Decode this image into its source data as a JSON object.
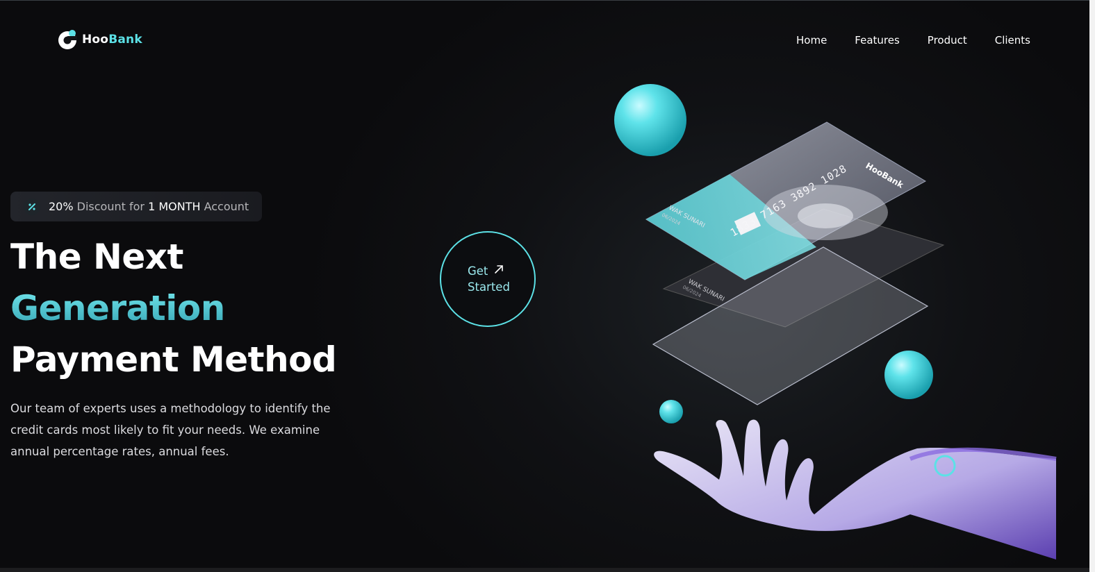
{
  "brand": {
    "name_part1": "Hoo",
    "name_part2": "Bank",
    "accent": "#5ce1e6"
  },
  "nav": {
    "items": [
      "Home",
      "Features",
      "Product",
      "Clients"
    ]
  },
  "badge": {
    "icon": "discount-icon",
    "percent": "20%",
    "text1": " Discount for ",
    "highlight": "1 MONTH",
    "text2": " Account"
  },
  "hero": {
    "line1": "The Next",
    "line2": "Generation",
    "line3": "Payment Method",
    "description": "Our team of experts uses a methodology to identify the credit cards most likely to fit your needs. We examine annual percentage rates, annual fees."
  },
  "cta": {
    "line1": "Get",
    "line2": "Started",
    "icon": "arrow-up-right-icon"
  },
  "card_front": {
    "number": "1833 7163 3892 1028",
    "holder": "WAK SUNARI",
    "expiry": "06/2024",
    "logo": "HooBank"
  },
  "card_back": {
    "holder": "WAK SUNARI",
    "expiry": "06/2024"
  }
}
